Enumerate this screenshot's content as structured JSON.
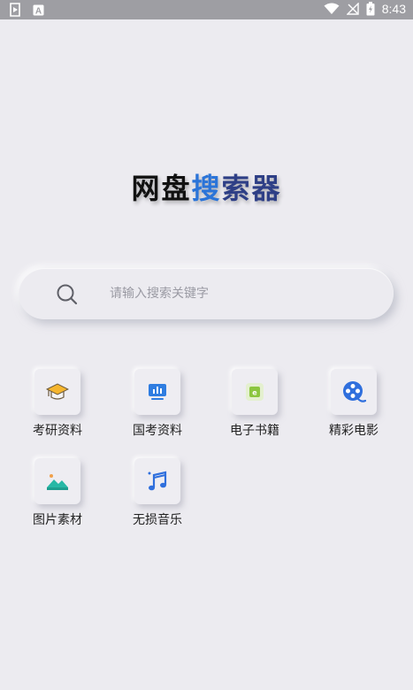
{
  "status_bar": {
    "time": "8:43"
  },
  "app": {
    "title_part1": "网盘",
    "title_part2": "搜",
    "title_part3": "索器"
  },
  "search": {
    "placeholder": "请输入搜索关键字"
  },
  "categories": [
    {
      "label": "考研资料",
      "icon": "graduation-cap-icon"
    },
    {
      "label": "国考资料",
      "icon": "presentation-board-icon"
    },
    {
      "label": "电子书籍",
      "icon": "ebook-icon"
    },
    {
      "label": "精彩电影",
      "icon": "film-reel-icon"
    },
    {
      "label": "图片素材",
      "icon": "landscape-image-icon"
    },
    {
      "label": "无损音乐",
      "icon": "music-note-icon"
    }
  ],
  "colors": {
    "background": "#ecebf0",
    "accent_blue": "#2b74d8",
    "accent_navy": "#2e3f86"
  }
}
